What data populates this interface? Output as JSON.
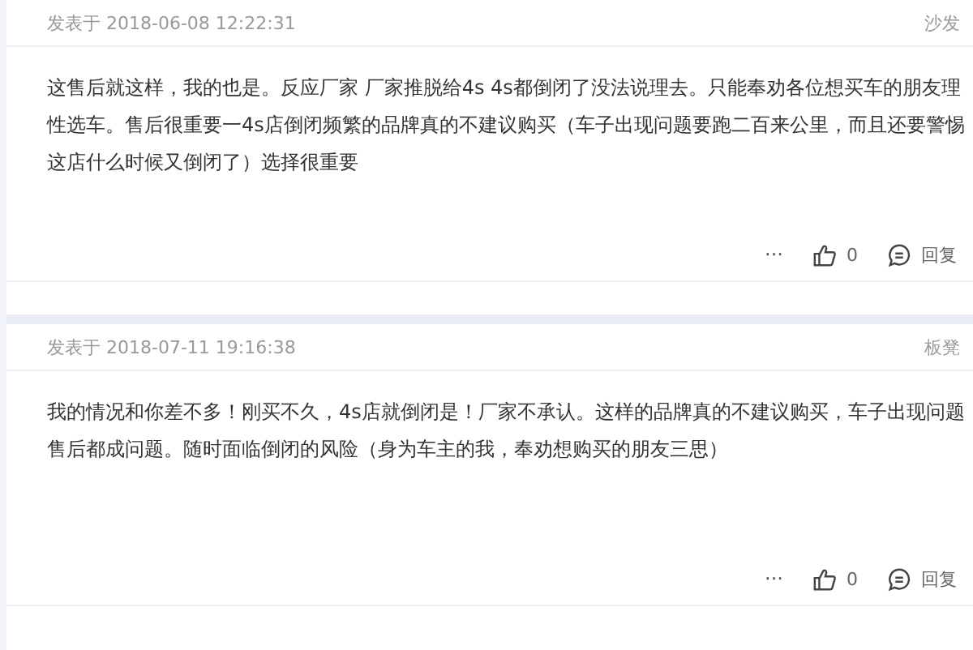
{
  "posts": [
    {
      "posted": "发表于 2018-06-08 12:22:31",
      "floor": "沙发",
      "body": "这售后就这样，我的也是。反应厂家 厂家推脱给4s 4s都倒闭了没法说理去。只能奉劝各位想买车的朋友理性选车。售后很重要一4s店倒闭频繁的品牌真的不建议购买（车子出现问题要跑二百来公里，而且还要警惕这店什么时候又倒闭了）选择很重要",
      "more": "···",
      "likes": "0",
      "reply": "回复"
    },
    {
      "posted": "发表于 2018-07-11 19:16:38",
      "floor": "板凳",
      "body": "我的情况和你差不多！刚买不久，4s店就倒闭是！厂家不承认。这样的品牌真的不建议购买，车子出现问题售后都成问题。随时面临倒闭的风险（身为车主的我，奉劝想购买的朋友三思）",
      "more": "···",
      "likes": "0",
      "reply": "回复"
    }
  ]
}
